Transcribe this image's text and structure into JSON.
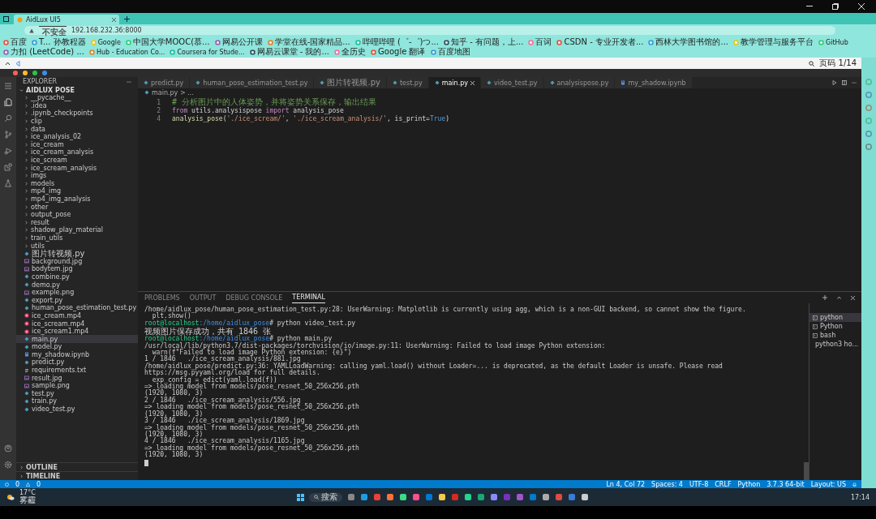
{
  "browser": {
    "tab_title": "AidLux UI5",
    "security": "不安全",
    "url": "192.168.232.36:8000",
    "bookmarks": [
      "百度",
      "T... 孙教程器",
      "Google",
      "中国大学MOOC(慕...",
      "网易公开课",
      "学堂在线-国家精品...",
      "哔哩哔哩 (゜-゜)つ...",
      "知乎 - 有问题，上...",
      "百词",
      "CSDN - 专业开发者...",
      "西林大学图书馆的...",
      "教学管理与服务平台",
      "GitHub",
      "力扣 (LeetCode) ...",
      "Hub - Education Co...",
      "Coursera for Stude...",
      "网易云课堂 - 我的...",
      "全历史",
      "Google 翻译",
      "百度地图"
    ],
    "page_counter": "页码 1/14"
  },
  "explorer": {
    "title": "EXPLORER",
    "root": "AIDLUX POSE",
    "items": [
      {
        "name": "__pycache__",
        "kind": "folder",
        "selected": false
      },
      {
        "name": ".idea",
        "kind": "folder",
        "selected": false
      },
      {
        "name": ".ipynb_checkpoints",
        "kind": "folder",
        "selected": false
      },
      {
        "name": "clip",
        "kind": "folder",
        "selected": false
      },
      {
        "name": "data",
        "kind": "folder",
        "selected": false
      },
      {
        "name": "ice_analysis_02",
        "kind": "folder",
        "selected": false
      },
      {
        "name": "ice_cream",
        "kind": "folder",
        "selected": false
      },
      {
        "name": "ice_cream_analysis",
        "kind": "folder",
        "selected": false
      },
      {
        "name": "ice_scream",
        "kind": "folder",
        "selected": false
      },
      {
        "name": "ice_scream_analysis",
        "kind": "folder",
        "selected": false
      },
      {
        "name": "imgs",
        "kind": "folder",
        "selected": false
      },
      {
        "name": "models",
        "kind": "folder",
        "selected": false
      },
      {
        "name": "mp4_img",
        "kind": "folder",
        "selected": false
      },
      {
        "name": "mp4_img_analysis",
        "kind": "folder",
        "selected": false
      },
      {
        "name": "other",
        "kind": "folder",
        "selected": false
      },
      {
        "name": "output_pose",
        "kind": "folder",
        "selected": false
      },
      {
        "name": "result",
        "kind": "folder",
        "selected": false
      },
      {
        "name": "shadow_play_material",
        "kind": "folder",
        "selected": false
      },
      {
        "name": "train_utils",
        "kind": "folder",
        "selected": false
      },
      {
        "name": "utils",
        "kind": "folder",
        "selected": false
      },
      {
        "name": "图片转视频.py",
        "kind": "python",
        "selected": false
      },
      {
        "name": "background.jpg",
        "kind": "image",
        "selected": false
      },
      {
        "name": "bodytem.jpg",
        "kind": "image",
        "selected": false
      },
      {
        "name": "combine.py",
        "kind": "python",
        "selected": false
      },
      {
        "name": "demo.py",
        "kind": "python",
        "selected": false
      },
      {
        "name": "example.png",
        "kind": "image",
        "selected": false
      },
      {
        "name": "export.py",
        "kind": "python",
        "selected": false
      },
      {
        "name": "human_pose_estimation_test.py",
        "kind": "python",
        "selected": false
      },
      {
        "name": "ice_cream.mp4",
        "kind": "video",
        "selected": false
      },
      {
        "name": "ice_scream.mp4",
        "kind": "video",
        "selected": false
      },
      {
        "name": "ice_scream1.mp4",
        "kind": "video",
        "selected": false
      },
      {
        "name": "main.py",
        "kind": "python",
        "selected": true
      },
      {
        "name": "model.py",
        "kind": "python",
        "selected": false
      },
      {
        "name": "my_shadow.ipynb",
        "kind": "notebook",
        "selected": false
      },
      {
        "name": "predict.py",
        "kind": "python",
        "selected": false
      },
      {
        "name": "requirements.txt",
        "kind": "text",
        "selected": false
      },
      {
        "name": "result.jpg",
        "kind": "image",
        "selected": false
      },
      {
        "name": "sample.png",
        "kind": "image",
        "selected": false
      },
      {
        "name": "test.py",
        "kind": "python",
        "selected": false
      },
      {
        "name": "train.py",
        "kind": "python",
        "selected": false
      },
      {
        "name": "video_test.py",
        "kind": "python",
        "selected": false
      }
    ],
    "sections": [
      "OUTLINE",
      "TIMELINE"
    ]
  },
  "editor": {
    "tabs": [
      {
        "label": "predict.py",
        "kind": "python",
        "selected": false
      },
      {
        "label": "human_pose_estimation_test.py",
        "kind": "python",
        "selected": false
      },
      {
        "label": "图片转视频.py",
        "kind": "python",
        "selected": false
      },
      {
        "label": "test.py",
        "kind": "python",
        "selected": false
      },
      {
        "label": "main.py",
        "kind": "python",
        "selected": true
      },
      {
        "label": "video_test.py",
        "kind": "python",
        "selected": false
      },
      {
        "label": "analysispose.py",
        "kind": "python",
        "selected": false
      },
      {
        "label": "my_shadow.ipynb",
        "kind": "notebook",
        "selected": false
      }
    ],
    "breadcrumb": "main.py > ...",
    "lines": [
      {
        "num": "1",
        "tokens": [
          {
            "kind": "comment",
            "text": "# 分析图片中的人体姿势，并将姿势关系保存，输出结果"
          }
        ]
      },
      {
        "num": "2",
        "tokens": [
          {
            "kind": "keyword",
            "text": "from"
          },
          {
            "kind": "plain",
            "text": " utils.analysispose "
          },
          {
            "kind": "keyword",
            "text": "import"
          },
          {
            "kind": "plain",
            "text": " analysis_pose"
          }
        ]
      },
      {
        "num": "4",
        "tokens": [
          {
            "kind": "function",
            "text": "analysis_pose"
          },
          {
            "kind": "plain",
            "text": "("
          },
          {
            "kind": "string",
            "text": "'./ice_scream/'"
          },
          {
            "kind": "plain",
            "text": ", "
          },
          {
            "kind": "string",
            "text": "'./ice_scream_analysis/'"
          },
          {
            "kind": "plain",
            "text": ", is_print="
          },
          {
            "kind": "constant",
            "text": "True"
          },
          {
            "kind": "plain",
            "text": ")"
          }
        ]
      }
    ]
  },
  "panel": {
    "tabs": [
      {
        "label": "PROBLEMS",
        "selected": false
      },
      {
        "label": "OUTPUT",
        "selected": false
      },
      {
        "label": "DEBUG CONSOLE",
        "selected": false
      },
      {
        "label": "TERMINAL",
        "selected": true
      }
    ],
    "terminal_lines": [
      {
        "kind": "output",
        "text": "/home/aidlux_pose/human_pose_estimation_test.py:28: UserWarning: Matplotlib is currently using agg, which is a non-GUI backend, so cannot show the figure."
      },
      {
        "kind": "output",
        "text": "  plt.show()"
      },
      {
        "kind": "prompt",
        "user": "root@localhost",
        "path": ":/home/aidlux_pose",
        "text": "# python video_test.py"
      },
      {
        "kind": "output",
        "text": "视频图片保存成功，共有 1846 张"
      },
      {
        "kind": "prompt",
        "user": "root@localhost",
        "path": ":/home/aidlux_pose",
        "text": "# python main.py"
      },
      {
        "kind": "output",
        "text": "/usr/local/lib/python3.7/dist-packages/torchvision/io/image.py:11: UserWarning: Failed to load image Python extension:"
      },
      {
        "kind": "output",
        "text": "  warn(f\"Failed to load image Python extension: {e}\")"
      },
      {
        "kind": "output",
        "text": "1 / 1846   ./ice_scream_analysis/881.jpg"
      },
      {
        "kind": "output",
        "text": "/home/aidlux_pose/predict.py:36: YAMLLoadWarning: calling yaml.load() without Loader=... is deprecated, as the default Loader is unsafe. Please read https://msg.pyyaml.org/load for full details."
      },
      {
        "kind": "output",
        "text": "  exp_config = edict(yaml.load(f))"
      },
      {
        "kind": "output",
        "text": "=> loading model from models/pose_resnet_50_256x256.pth"
      },
      {
        "kind": "output",
        "text": "(1920, 1080, 3)"
      },
      {
        "kind": "output",
        "text": "2 / 1846   ./ice_scream_analysis/556.jpg"
      },
      {
        "kind": "output",
        "text": "=> loading model from models/pose_resnet_50_256x256.pth"
      },
      {
        "kind": "output",
        "text": "(1920, 1080, 3)"
      },
      {
        "kind": "output",
        "text": "3 / 1846   ./ice_scream_analysis/1869.jpg"
      },
      {
        "kind": "output",
        "text": "=> loading model from models/pose_resnet_50_256x256.pth"
      },
      {
        "kind": "output",
        "text": "(1920, 1080, 3)"
      },
      {
        "kind": "output",
        "text": "4 / 1846   ./ice_scream_analysis/1165.jpg"
      },
      {
        "kind": "output",
        "text": "=> loading model from models/pose_resnet_50_256x256.pth"
      },
      {
        "kind": "output",
        "text": "(1920, 1080, 3)"
      }
    ],
    "terminals": [
      {
        "label": "python",
        "selected": true
      },
      {
        "label": "Python",
        "selected": false
      },
      {
        "label": "bash",
        "selected": false
      },
      {
        "label": "python3 ho...",
        "selected": false
      }
    ]
  },
  "status_bar": {
    "errors": "0",
    "warnings": "0",
    "items": [
      "Ln 4, Col 72",
      "Spaces: 4",
      "UTF-8",
      "CRLF",
      "Python",
      "3.7.3 64-bit",
      "Layout: US"
    ]
  },
  "taskbar": {
    "temperature": "17°C",
    "weather": "雾霾",
    "search": "搜索",
    "time": "17:14"
  }
}
